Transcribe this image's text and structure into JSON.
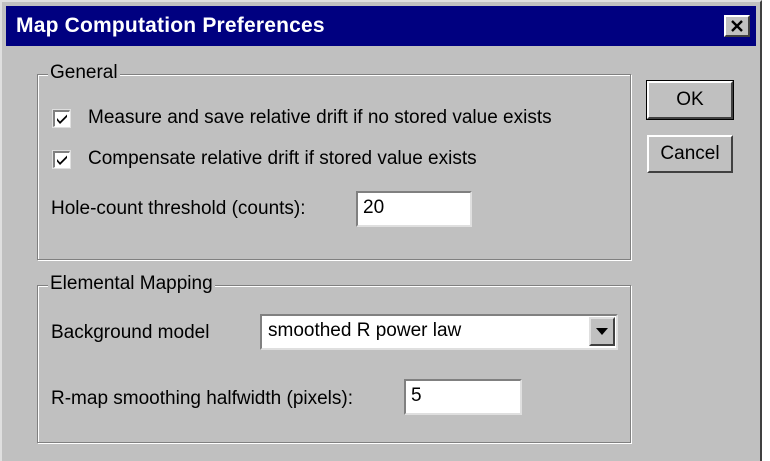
{
  "window": {
    "title": "Map Computation Preferences",
    "close_glyph": "✕"
  },
  "general": {
    "legend": "General",
    "measure_drift": {
      "label": "Measure and save relative drift if no stored value exists",
      "checked": true
    },
    "compensate_drift": {
      "label": "Compensate relative drift if stored value exists",
      "checked": true
    },
    "hole_count": {
      "label": "Hole-count threshold (counts):",
      "value": "20"
    }
  },
  "elemental": {
    "legend": "Elemental Mapping",
    "background_model": {
      "label": "Background model",
      "value": "smoothed R power law"
    },
    "smoothing": {
      "label": "R-map smoothing halfwidth (pixels):",
      "value": "5"
    }
  },
  "buttons": {
    "ok": "OK",
    "cancel": "Cancel"
  },
  "icons": {
    "close": "close-icon",
    "check": "checkmark-icon",
    "dropdown": "dropdown-arrow-icon"
  },
  "colors": {
    "titlebar": "#000080",
    "face": "#c0c0c0"
  }
}
